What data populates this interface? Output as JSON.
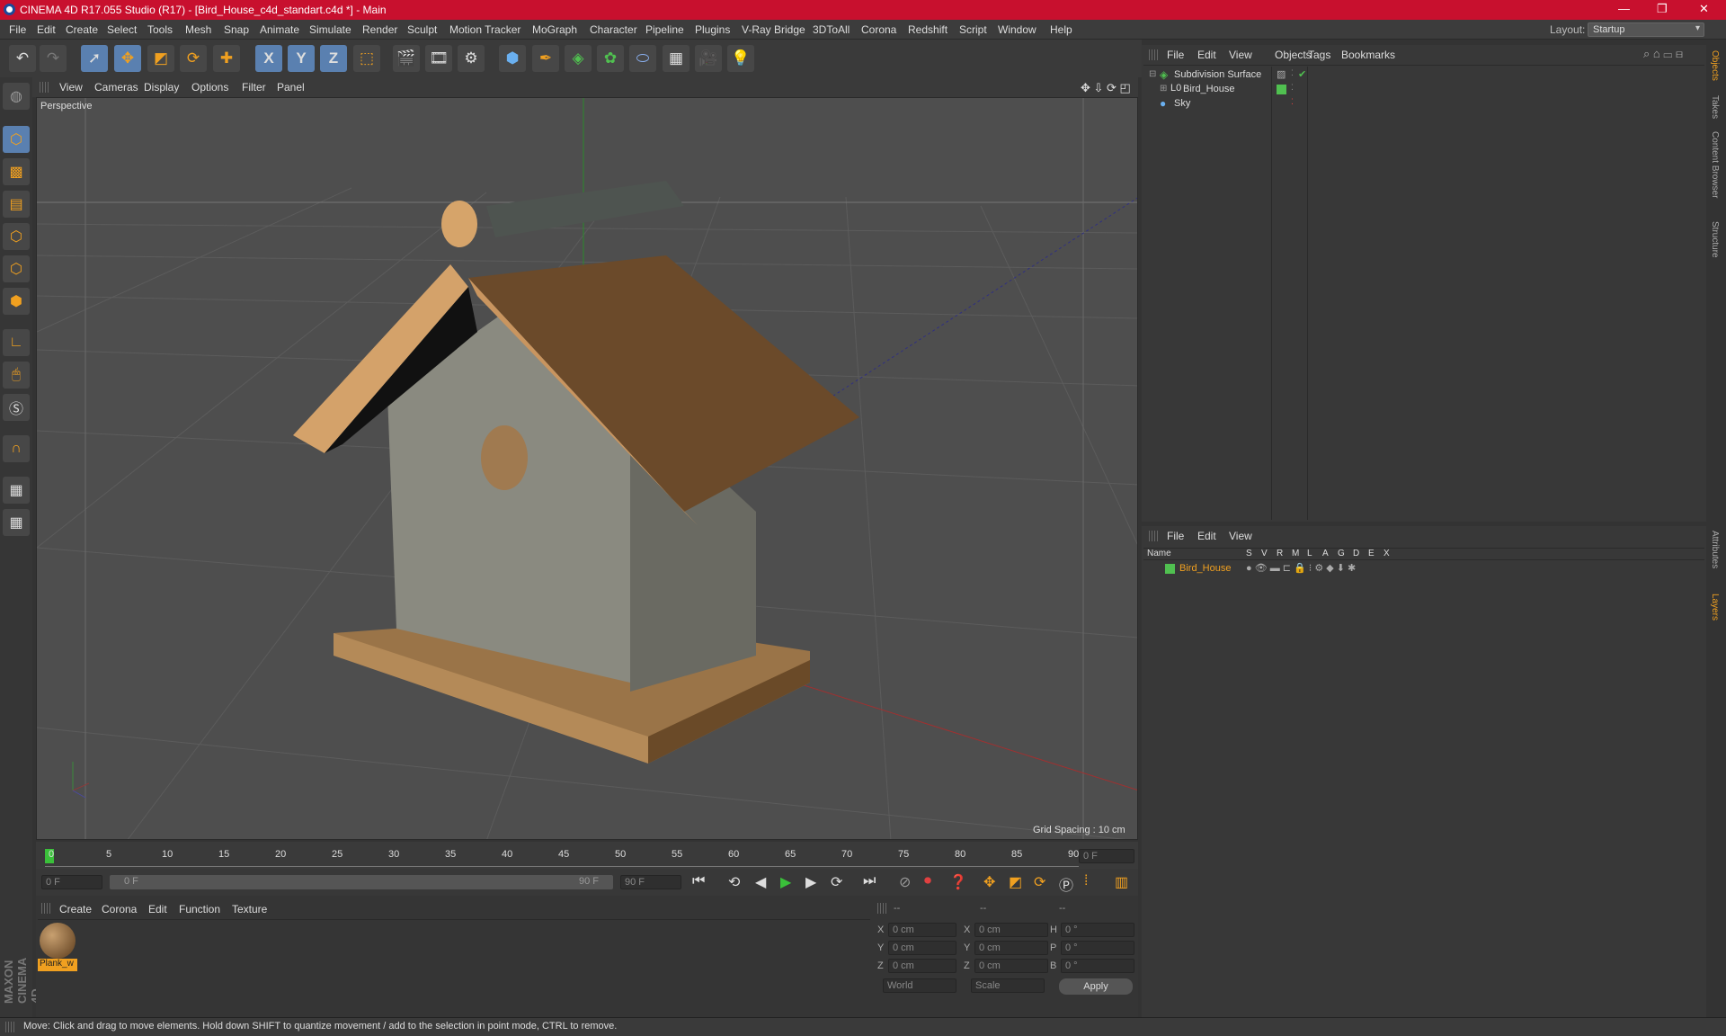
{
  "window": {
    "title": "CINEMA 4D R17.055 Studio (R17) - [Bird_House_c4d_standart.c4d *] - Main"
  },
  "menubar": {
    "items": [
      "File",
      "Edit",
      "Create",
      "Select",
      "Tools",
      "Mesh",
      "Snap",
      "Animate",
      "Simulate",
      "Render",
      "Sculpt",
      "Motion Tracker",
      "MoGraph",
      "Character",
      "Pipeline",
      "Plugins",
      "V-Ray Bridge",
      "3DToAll",
      "Corona",
      "Redshift",
      "Script",
      "Window",
      "Help"
    ],
    "layout_label": "Layout:",
    "layout_value": "Startup"
  },
  "toolbar": {
    "axis_x": "X",
    "axis_y": "Y",
    "axis_z": "Z"
  },
  "viewport": {
    "menu": [
      "View",
      "Cameras",
      "Display",
      "Options",
      "Filter",
      "Panel"
    ],
    "label": "Perspective",
    "grid_spacing": "Grid Spacing : 10 cm"
  },
  "timeline": {
    "ticks": [
      "0",
      "5",
      "10",
      "15",
      "20",
      "25",
      "30",
      "35",
      "40",
      "45",
      "50",
      "55",
      "60",
      "65",
      "70",
      "75",
      "80",
      "85",
      "90"
    ],
    "current_frame": "0 F"
  },
  "transport": {
    "start": "0 F",
    "range_start": "0 F",
    "range_end": "90 F",
    "end": "90 F"
  },
  "materials": {
    "menu": [
      "Create",
      "Corona",
      "Edit",
      "Function",
      "Texture"
    ],
    "items": [
      {
        "name": "Plank_w"
      }
    ]
  },
  "coords": {
    "head1": "--",
    "head2": "--",
    "head3": "--",
    "rows": [
      {
        "a": "X",
        "av": "0 cm",
        "b": "X",
        "bv": "0 cm",
        "c": "H",
        "cv": "0 °"
      },
      {
        "a": "Y",
        "av": "0 cm",
        "b": "Y",
        "bv": "0 cm",
        "c": "P",
        "cv": "0 °"
      },
      {
        "a": "Z",
        "av": "0 cm",
        "b": "Z",
        "bv": "0 cm",
        "c": "B",
        "cv": "0 °"
      }
    ],
    "world": "World",
    "scale": "Scale",
    "apply": "Apply"
  },
  "objects": {
    "menu": [
      "File",
      "Edit",
      "View",
      "Objects",
      "Tags",
      "Bookmarks"
    ],
    "items": [
      {
        "name": "Subdivision Surface"
      },
      {
        "name": "Bird_House"
      },
      {
        "name": "Sky"
      }
    ]
  },
  "layers": {
    "menu": [
      "File",
      "Edit",
      "View"
    ],
    "columns": [
      "Name",
      "S",
      "V",
      "R",
      "M",
      "L",
      "A",
      "G",
      "D",
      "E",
      "X"
    ],
    "items": [
      {
        "name": "Bird_House"
      }
    ]
  },
  "right_tabs": [
    "Objects",
    "Takes",
    "Content Browser",
    "Structure",
    "Attributes",
    "Layers"
  ],
  "status": "Move: Click and drag to move elements. Hold down SHIFT to quantize movement / add to the selection in point mode, CTRL to remove.",
  "brand": {
    "logo_text": "MAXON CINEMA 4D"
  }
}
